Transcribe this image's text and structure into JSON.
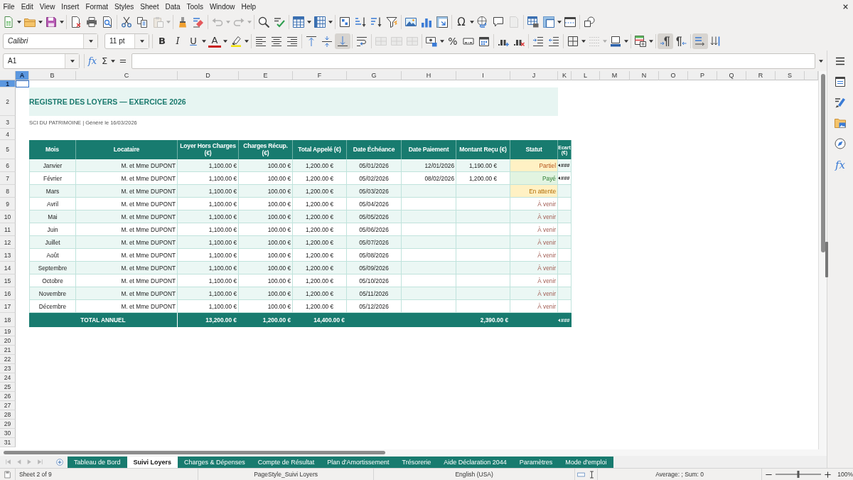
{
  "menu_bar": {
    "items": [
      "File",
      "Edit",
      "View",
      "Insert",
      "Format",
      "Styles",
      "Sheet",
      "Data",
      "Tools",
      "Window",
      "Help"
    ]
  },
  "standard_toolbar": {
    "paste_disabled": true,
    "undo_disabled": true,
    "redo_disabled": true,
    "header_footer_disabled": true,
    "special_character_label": "Ω"
  },
  "format_toolbar": {
    "font_name": "Calibri",
    "font_size": "11 pt",
    "bold_label": "B",
    "italic_label": "I",
    "underline_label": "U",
    "font_color_label": "A",
    "percent_label": "%",
    "vertical_align": {
      "top": false,
      "center": false,
      "bottom": true
    },
    "merge_disabled": true,
    "border_style_disabled": true,
    "paragraph_direction": {
      "left_to_right": true,
      "right_to_left": false
    },
    "text_orientation": {
      "horizontal": true,
      "vertical": false
    }
  },
  "formula_bar": {
    "cell_reference": "A1",
    "function_wizard_label": "fx",
    "sum_label": "Σ",
    "formula_label": "="
  },
  "sheet": {
    "column_headers": [
      {
        "label": "A",
        "selected": true
      },
      {
        "label": "B",
        "selected": false
      },
      {
        "label": "C",
        "selected": false
      },
      {
        "label": "D",
        "selected": false
      },
      {
        "label": "E",
        "selected": false
      },
      {
        "label": "F",
        "selected": false
      },
      {
        "label": "G",
        "selected": false
      },
      {
        "label": "H",
        "selected": false
      },
      {
        "label": "I",
        "selected": false
      },
      {
        "label": "J",
        "selected": false
      },
      {
        "label": "K",
        "selected": false
      },
      {
        "label": "L",
        "selected": false
      },
      {
        "label": "M",
        "selected": false
      },
      {
        "label": "N",
        "selected": false
      },
      {
        "label": "O",
        "selected": false
      },
      {
        "label": "P",
        "selected": false
      },
      {
        "label": "Q",
        "selected": false
      },
      {
        "label": "R",
        "selected": false
      },
      {
        "label": "S",
        "selected": false
      }
    ],
    "row_headers": [
      {
        "label": "1",
        "selected": true
      },
      {
        "label": "2",
        "selected": false
      },
      {
        "label": "3",
        "selected": false
      },
      {
        "label": "4",
        "selected": false
      },
      {
        "label": "5",
        "selected": false
      },
      {
        "label": "6",
        "selected": false
      },
      {
        "label": "7",
        "selected": false
      },
      {
        "label": "8",
        "selected": false
      },
      {
        "label": "9",
        "selected": false
      },
      {
        "label": "10",
        "selected": false
      },
      {
        "label": "11",
        "selected": false
      },
      {
        "label": "12",
        "selected": false
      },
      {
        "label": "13",
        "selected": false
      },
      {
        "label": "14",
        "selected": false
      },
      {
        "label": "15",
        "selected": false
      },
      {
        "label": "16",
        "selected": false
      },
      {
        "label": "17",
        "selected": false
      },
      {
        "label": "18",
        "selected": false
      },
      {
        "label": "19",
        "selected": false
      },
      {
        "label": "20",
        "selected": false
      },
      {
        "label": "21",
        "selected": false
      },
      {
        "label": "22",
        "selected": false
      },
      {
        "label": "23",
        "selected": false
      },
      {
        "label": "24",
        "selected": false
      },
      {
        "label": "25",
        "selected": false
      },
      {
        "label": "26",
        "selected": false
      },
      {
        "label": "27",
        "selected": false
      },
      {
        "label": "28",
        "selected": false
      },
      {
        "label": "29",
        "selected": false
      },
      {
        "label": "30",
        "selected": false
      },
      {
        "label": "31",
        "selected": false
      }
    ],
    "title": "REGISTRE DES LOYERS — EXERCICE 2026",
    "subtitle": "SCI DU PATRIMOINE | Généré le 16/03/2026",
    "table": {
      "columns": [
        "Mois",
        "Locataire",
        "Loyer Hors Charges (€)",
        "Charges Récup. (€)",
        "Total Appelé (€)",
        "Date Échéance",
        "Date Paiement",
        "Montant Reçu (€)",
        "Statut",
        "Ecart (€)"
      ],
      "rows": [
        {
          "month": "Janvier",
          "tenant": "M. et Mme DUPONT",
          "rent": "1,100.00 €",
          "charges": "100.00 €",
          "total_due": "1,200.00 €",
          "due_date": "05/01/2026",
          "payment_date": "12/01/2026",
          "amount_received": "1,190.00 €",
          "status": {
            "label": "Partiel",
            "kind": "partial"
          },
          "difference": "###"
        },
        {
          "month": "Février",
          "tenant": "M. et Mme DUPONT",
          "rent": "1,100.00 €",
          "charges": "100.00 €",
          "total_due": "1,200.00 €",
          "due_date": "05/02/2026",
          "payment_date": "08/02/2026",
          "amount_received": "1,200.00 €",
          "status": {
            "label": "Payé",
            "kind": "paid"
          },
          "difference": "###"
        },
        {
          "month": "Mars",
          "tenant": "M. et Mme DUPONT",
          "rent": "1,100.00 €",
          "charges": "100.00 €",
          "total_due": "1,200.00 €",
          "due_date": "05/03/2026",
          "status": {
            "label": "En attente",
            "kind": "pending"
          }
        },
        {
          "month": "Avril",
          "tenant": "M. et Mme DUPONT",
          "rent": "1,100.00 €",
          "charges": "100.00 €",
          "total_due": "1,200.00 €",
          "due_date": "05/04/2026",
          "status": {
            "label": "À venir",
            "kind": "upcoming"
          }
        },
        {
          "month": "Mai",
          "tenant": "M. et Mme DUPONT",
          "rent": "1,100.00 €",
          "charges": "100.00 €",
          "total_due": "1,200.00 €",
          "due_date": "05/05/2026",
          "status": {
            "label": "À venir",
            "kind": "upcoming"
          }
        },
        {
          "month": "Juin",
          "tenant": "M. et Mme DUPONT",
          "rent": "1,100.00 €",
          "charges": "100.00 €",
          "total_due": "1,200.00 €",
          "due_date": "05/06/2026",
          "status": {
            "label": "À venir",
            "kind": "upcoming"
          }
        },
        {
          "month": "Juillet",
          "tenant": "M. et Mme DUPONT",
          "rent": "1,100.00 €",
          "charges": "100.00 €",
          "total_due": "1,200.00 €",
          "due_date": "05/07/2026",
          "status": {
            "label": "À venir",
            "kind": "upcoming"
          }
        },
        {
          "month": "Août",
          "tenant": "M. et Mme DUPONT",
          "rent": "1,100.00 €",
          "charges": "100.00 €",
          "total_due": "1,200.00 €",
          "due_date": "05/08/2026",
          "status": {
            "label": "À venir",
            "kind": "upcoming"
          }
        },
        {
          "month": "Septembre",
          "tenant": "M. et Mme DUPONT",
          "rent": "1,100.00 €",
          "charges": "100.00 €",
          "total_due": "1,200.00 €",
          "due_date": "05/09/2026",
          "status": {
            "label": "À venir",
            "kind": "upcoming"
          }
        },
        {
          "month": "Octobre",
          "tenant": "M. et Mme DUPONT",
          "rent": "1,100.00 €",
          "charges": "100.00 €",
          "total_due": "1,200.00 €",
          "due_date": "05/10/2026",
          "status": {
            "label": "À venir",
            "kind": "upcoming"
          }
        },
        {
          "month": "Novembre",
          "tenant": "M. et Mme DUPONT",
          "rent": "1,100.00 €",
          "charges": "100.00 €",
          "total_due": "1,200.00 €",
          "due_date": "05/11/2026",
          "status": {
            "label": "À venir",
            "kind": "upcoming"
          }
        },
        {
          "month": "Décembre",
          "tenant": "M. et Mme DUPONT",
          "rent": "1,100.00 €",
          "charges": "100.00 €",
          "total_due": "1,200.00 €",
          "due_date": "05/12/2026",
          "status": {
            "label": "À venir",
            "kind": "upcoming"
          }
        }
      ],
      "total": {
        "label": "TOTAL ANNUEL",
        "rent": "13,200.00 €",
        "charges": "1,200.00 €",
        "total_due": "14,400.00 €",
        "amount_received": "2,390.00 €",
        "difference": "###"
      }
    }
  },
  "sidebar": {
    "functions_label": "fx"
  },
  "sheet_tabs": {
    "navigation_disabled": true,
    "tabs": [
      {
        "label": "Tableau de Bord",
        "selected": false
      },
      {
        "label": "Suivi Loyers",
        "selected": true
      },
      {
        "label": "Charges & Dépenses",
        "selected": false
      },
      {
        "label": "Compte de Résultat",
        "selected": false
      },
      {
        "label": "Plan d'Amortissement",
        "selected": false
      },
      {
        "label": "Trésorerie",
        "selected": false
      },
      {
        "label": "Aide Déclaration 2044",
        "selected": false
      },
      {
        "label": "Paramètres",
        "selected": false
      },
      {
        "label": "Mode d'emploi",
        "selected": false
      }
    ]
  },
  "status_bar": {
    "sheet_position": "Sheet 2 of 9",
    "page_style": "PageStyle_Suivi Loyers",
    "language": "English (USA)",
    "selection_summary": "Average: ; Sum: 0",
    "zoom": {
      "level": 0.5,
      "reading": "100%"
    }
  }
}
